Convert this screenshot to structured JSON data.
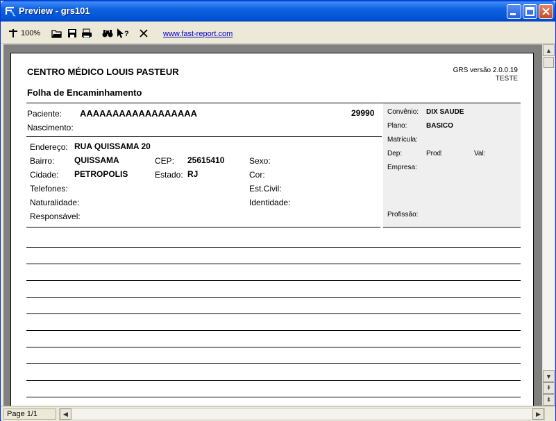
{
  "window": {
    "title": "Preview - grs101"
  },
  "toolbar": {
    "zoom_label": "100%",
    "link_text": "www.fast-report.com"
  },
  "report": {
    "institution": "CENTRO MÉDICO LOUIS PASTEUR",
    "form_title": "Folha de Encaminhamento",
    "version": "GRS versão 2.0.0.19",
    "mode": "TESTE",
    "patient": {
      "name_label": "Paciente:",
      "name": "AAAAAAAAAAAAAAAAAA",
      "code": "29990",
      "birth_label": "Nascimento:"
    },
    "address": {
      "street_label": "Endereço:",
      "street": "RUA QUISSAMA 20",
      "district_label": "Bairro:",
      "district": "QUISSAMA",
      "zip_label": "CEP:",
      "zip": "25615410",
      "sex_label": "Sexo:",
      "city_label": "Cidade:",
      "city": "PETROPOLIS",
      "state_label": "Estado:",
      "state": "RJ",
      "color_label": "Cor:",
      "phones_label": "Telefones:",
      "civil_label": "Est.Civil:",
      "origin_label": "Naturalidade:",
      "id_label": "Identidade:",
      "guardian_label": "Responsável:"
    },
    "insurance": {
      "plan_provider_label": "Convênio:",
      "plan_provider": "DIX SAUDE",
      "plan_label": "Plano:",
      "plan": "BASICO",
      "registration_label": "Matrícula:",
      "dep_label": "Dep:",
      "prod_label": "Prod:",
      "val_label": "Val:",
      "company_label": "Empresa:",
      "profession_label": "Profissão:"
    }
  },
  "status": {
    "page": "Page 1/1"
  }
}
